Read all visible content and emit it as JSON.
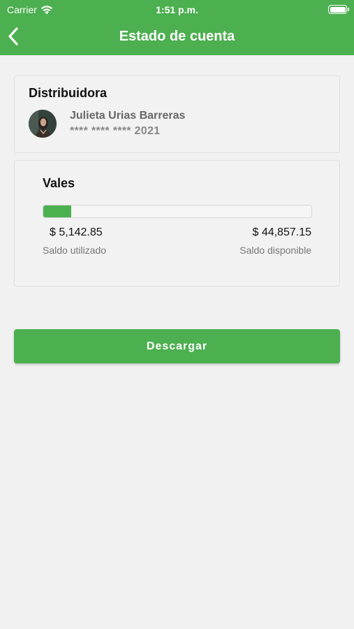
{
  "status_bar": {
    "carrier": "Carrier",
    "time": "1:51 p.m."
  },
  "nav": {
    "title": "Estado de cuenta",
    "back_icon": "chevron-left-icon"
  },
  "distributor": {
    "heading": "Distribuidora",
    "name": "Julieta Urias Barreras",
    "card_number": "**** **** **** 2021"
  },
  "vales": {
    "heading": "Vales",
    "used_amount": "$ 5,142.85",
    "used_label": "Saldo utilizado",
    "available_amount": "$ 44,857.15",
    "available_label": "Saldo disponible",
    "used_fraction": 0.103
  },
  "actions": {
    "download_label": "Descargar"
  },
  "colors": {
    "primary": "#4caf50",
    "background": "#f1f1f1"
  }
}
